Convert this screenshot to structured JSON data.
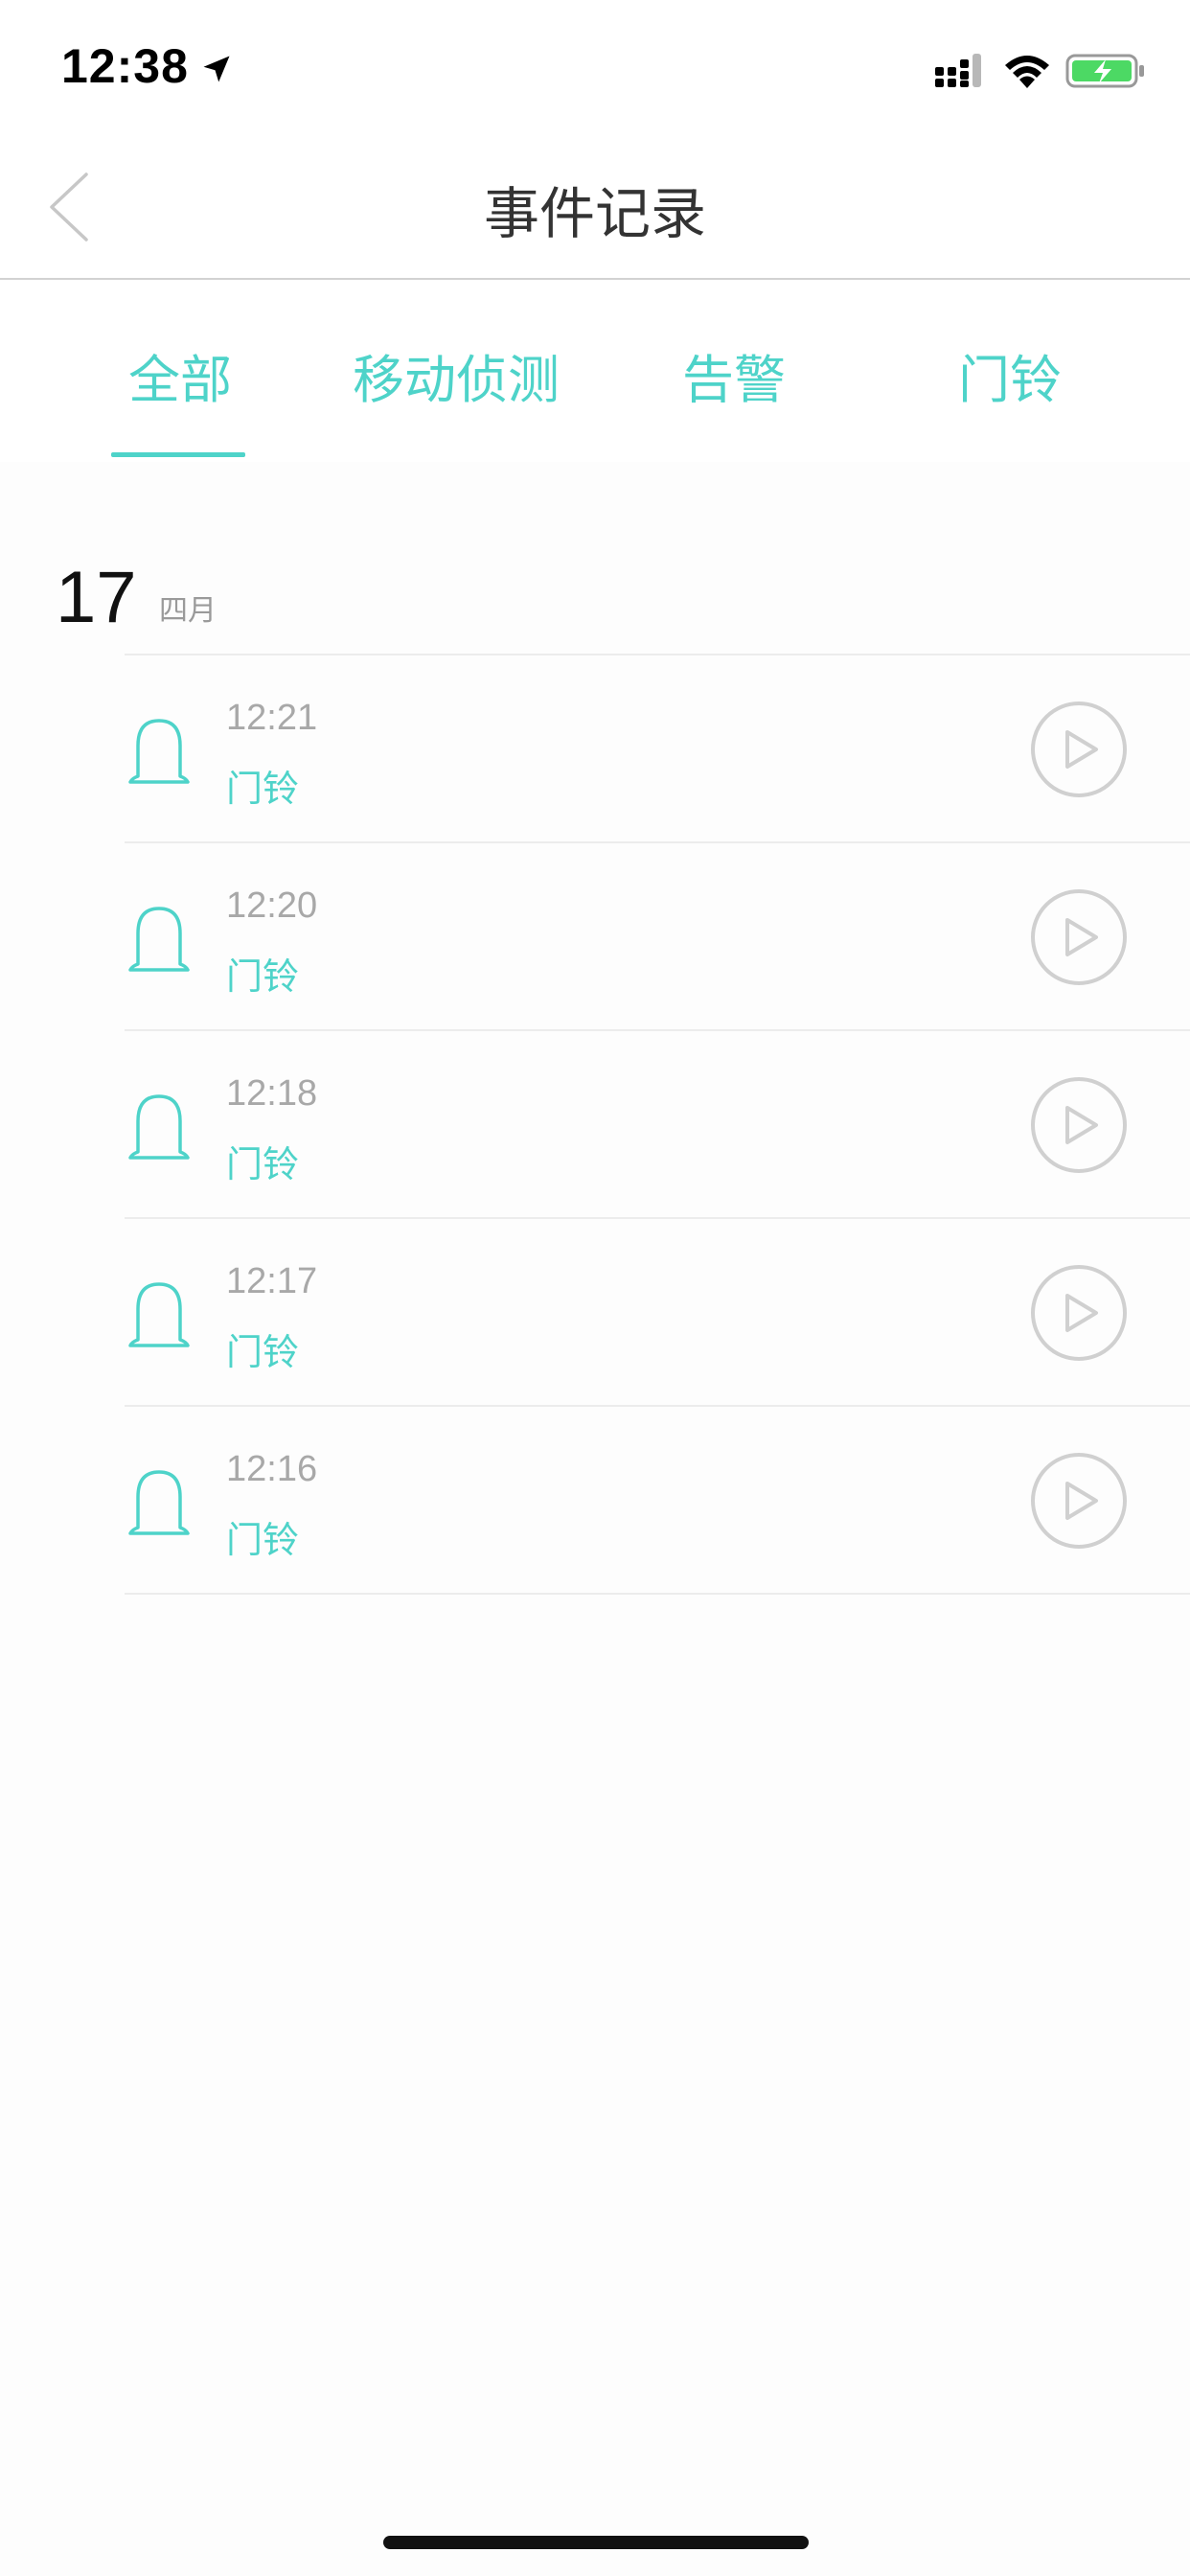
{
  "status_bar": {
    "time": "12:38",
    "location_icon": "location-arrow-icon",
    "signal_icon": "cellular-signal-icon",
    "wifi_icon": "wifi-icon",
    "battery_icon": "battery-charging-icon"
  },
  "nav": {
    "title": "事件记录",
    "back_icon": "chevron-left-icon"
  },
  "tabs": [
    {
      "label": "全部",
      "active": true
    },
    {
      "label": "移动侦测",
      "active": false
    },
    {
      "label": "告警",
      "active": false
    },
    {
      "label": "门铃",
      "active": false
    }
  ],
  "date_group": {
    "day": "17",
    "month": "四月"
  },
  "events": [
    {
      "time": "12:21",
      "type": "门铃",
      "icon": "bell-icon",
      "action_icon": "play-icon"
    },
    {
      "time": "12:20",
      "type": "门铃",
      "icon": "bell-icon",
      "action_icon": "play-icon"
    },
    {
      "time": "12:18",
      "type": "门铃",
      "icon": "bell-icon",
      "action_icon": "play-icon"
    },
    {
      "time": "12:17",
      "type": "门铃",
      "icon": "bell-icon",
      "action_icon": "play-icon"
    },
    {
      "time": "12:16",
      "type": "门铃",
      "icon": "bell-icon",
      "action_icon": "play-icon"
    }
  ],
  "colors": {
    "accent": "#4ed3c9",
    "secondary_text": "#a8a8a8",
    "play_icon": "#d0d0d0",
    "title_text": "#333333"
  }
}
